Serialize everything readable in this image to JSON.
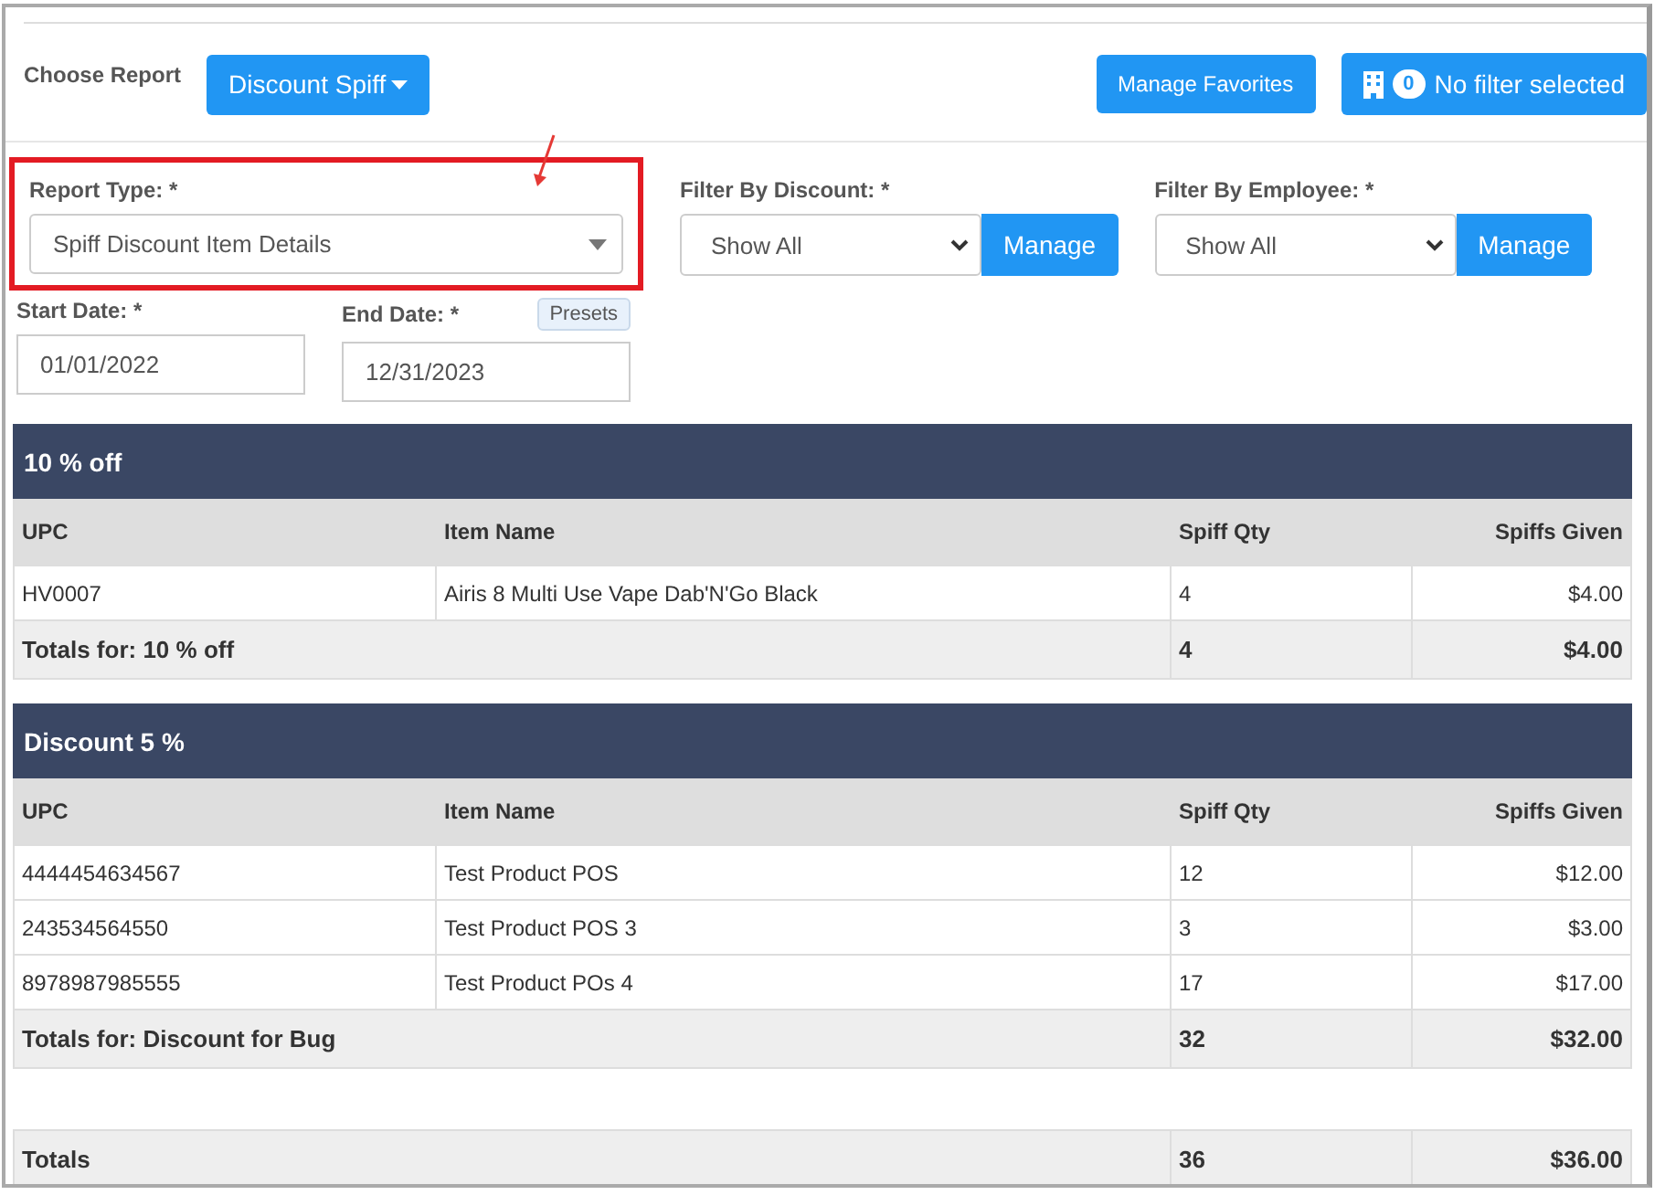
{
  "toolbar": {
    "choose_label": "Choose Report",
    "report_button": "Discount Spiff",
    "favorites_button": "Manage Favorites",
    "filter_count": "0",
    "filter_button": "No filter selected"
  },
  "filters": {
    "report_type": {
      "label": "Report Type: *",
      "value": "Spiff Discount Item Details",
      "highlighted": true
    },
    "discount": {
      "label": "Filter By Discount: *",
      "value": "Show All",
      "button": "Manage"
    },
    "employee": {
      "label": "Filter By Employee: *",
      "value": "Show All",
      "button": "Manage"
    },
    "start_date": {
      "label": "Start Date: *",
      "value": "01/01/2022"
    },
    "end_date": {
      "label": "End Date: *",
      "value": "12/31/2023"
    },
    "presets": "Presets"
  },
  "table": {
    "groups": [
      {
        "title": "10 % off",
        "columns": [
          "UPC",
          "Item Name",
          "Spiff Qty",
          "Spiffs Given"
        ],
        "rows": [
          [
            "HV0007",
            "Airis 8 Multi Use Vape Dab'N'Go Black",
            "4",
            "$4.00"
          ]
        ],
        "totals": [
          "Totals for: 10 % off",
          "4",
          "$4.00"
        ]
      },
      {
        "title": "Discount  5 %",
        "columns": [
          "UPC",
          "Item Name",
          "Spiff Qty",
          "Spiffs Given"
        ],
        "rows": [
          [
            "4444454634567",
            "Test Product POS",
            "12",
            "$12.00"
          ],
          [
            "243534564550",
            "Test Product POS 3",
            "3",
            "$3.00"
          ],
          [
            "8978987985555",
            "Test Product POs 4",
            "17",
            "$17.00"
          ]
        ],
        "totals": [
          "Totals for: Discount for Bug",
          "32",
          "$32.00"
        ]
      }
    ],
    "grand_totals": [
      "Totals",
      "36",
      "$36.00"
    ]
  }
}
